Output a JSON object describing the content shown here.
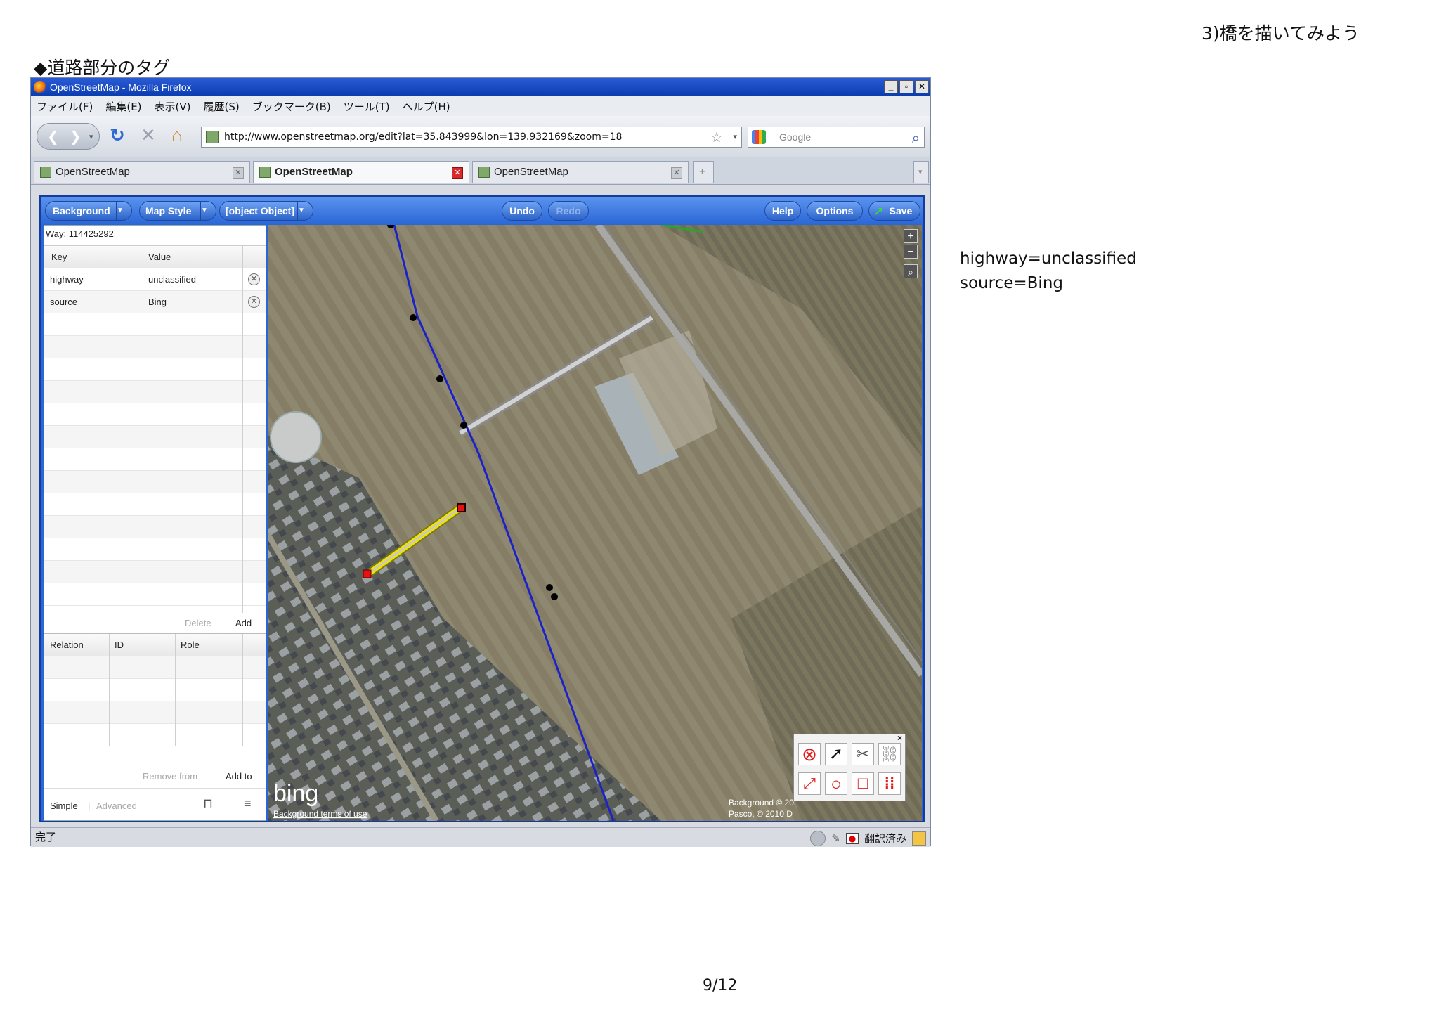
{
  "slide": {
    "header": "3)橋を描いてみよう",
    "section_title": "◆道路部分のタグ",
    "notes": [
      "highway=unclassified",
      "source=Bing"
    ],
    "page": "9/12"
  },
  "browser": {
    "title": "OpenStreetMap - Mozilla Firefox",
    "menu": [
      "ファイル(F)",
      "編集(E)",
      "表示(V)",
      "履歴(S)",
      "ブックマーク(B)",
      "ツール(T)",
      "ヘルプ(H)"
    ],
    "url": "http://www.openstreetmap.org/edit?lat=35.843999&lon=139.932169&zoom=18",
    "search_placeholder": "Google",
    "tabs": [
      "OpenStreetMap",
      "OpenStreetMap",
      "OpenStreetMap"
    ],
    "status": "完了",
    "status_translate": "翻訳済み"
  },
  "editor": {
    "toolbar": {
      "background": "Background",
      "map_style": "Map Style",
      "object": "[object Object]",
      "undo": "Undo",
      "redo": "Redo",
      "help": "Help",
      "options": "Options",
      "save": "Save"
    },
    "way_label": "Way: 114425292",
    "tags": {
      "key_header": "Key",
      "value_header": "Value",
      "rows": [
        {
          "key": "highway",
          "value": "unclassified"
        },
        {
          "key": "source",
          "value": "Bing"
        }
      ],
      "delete": "Delete",
      "add": "Add"
    },
    "relations": {
      "relation_header": "Relation",
      "id_header": "ID",
      "role_header": "Role",
      "remove_from": "Remove from",
      "add_to": "Add to"
    },
    "mode": {
      "simple": "Simple",
      "advanced": "Advanced"
    },
    "map": {
      "attribution_bg": "Background © 20",
      "attribution_pasco": "Pasco, © 2010 D",
      "terms": "Background terms of use",
      "bing": "bing"
    }
  },
  "colors": {
    "accent": "#2a66d6",
    "selected_way": "#f2e400",
    "waterway": "#1a22c8"
  }
}
